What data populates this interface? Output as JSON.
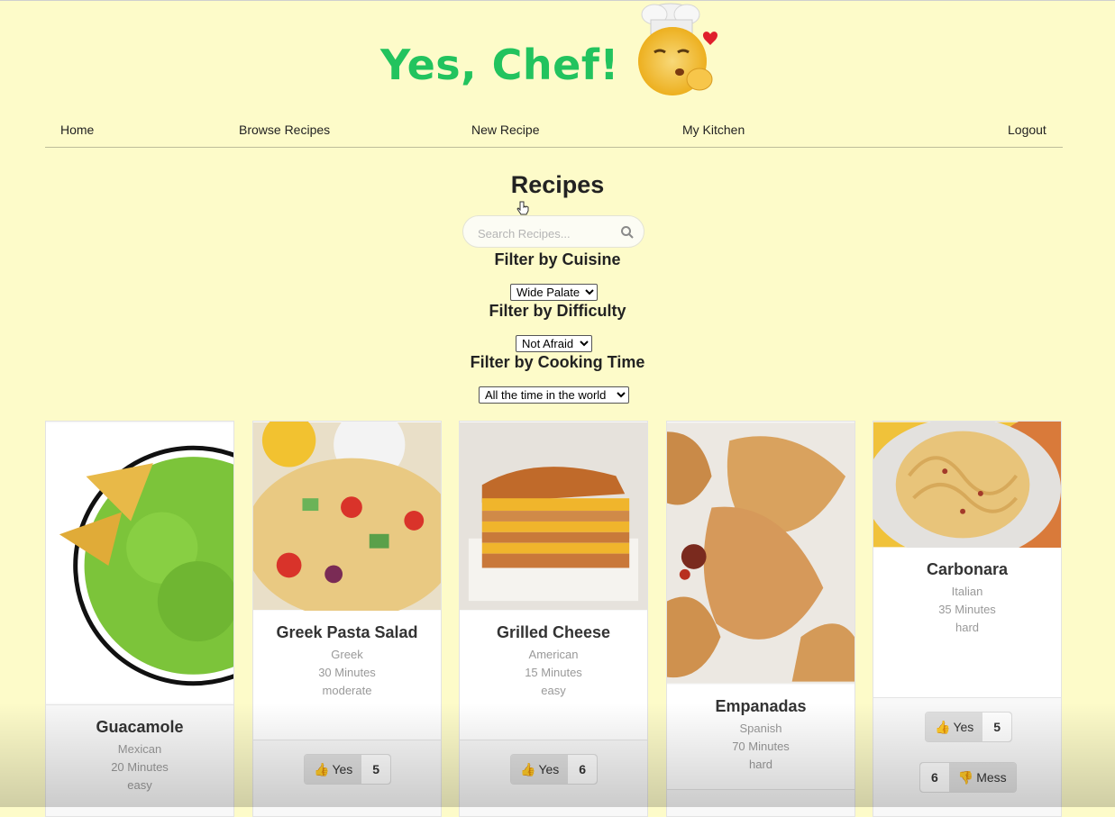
{
  "app": {
    "title": "Yes, Chef!"
  },
  "nav": {
    "home": "Home",
    "browse": "Browse Recipes",
    "new_recipe": "New Recipe",
    "my_kitchen": "My Kitchen",
    "logout": "Logout"
  },
  "page": {
    "heading": "Recipes"
  },
  "search": {
    "placeholder": "Search Recipes..."
  },
  "filters": {
    "cuisine": {
      "label": "Filter by Cuisine",
      "selected": "Wide Palate"
    },
    "difficulty": {
      "label": "Filter by Difficulty",
      "selected": "Not Afraid"
    },
    "time": {
      "label": "Filter by Cooking Time",
      "selected": "All the time in the world"
    }
  },
  "recipes": [
    {
      "name": "Guacamole",
      "cuisine": "Mexican",
      "time": "20 Minutes",
      "difficulty": "easy"
    },
    {
      "name": "Greek Pasta Salad",
      "cuisine": "Greek",
      "time": "30 Minutes",
      "difficulty": "moderate",
      "yes_label": "Yes",
      "yes_count": "5"
    },
    {
      "name": "Grilled Cheese",
      "cuisine": "American",
      "time": "15 Minutes",
      "difficulty": "easy",
      "yes_label": "Yes",
      "yes_count": "6"
    },
    {
      "name": "Empanadas",
      "cuisine": "Spanish",
      "time": "70 Minutes",
      "difficulty": "hard"
    },
    {
      "name": "Carbonara",
      "cuisine": "Italian",
      "time": "35 Minutes",
      "difficulty": "hard",
      "yes_label": "Yes",
      "yes_count": "5",
      "mess_label": "Mess",
      "mess_count": "6"
    }
  ],
  "colors": {
    "background": "#fdfbc9",
    "logo": "#22c35e"
  }
}
